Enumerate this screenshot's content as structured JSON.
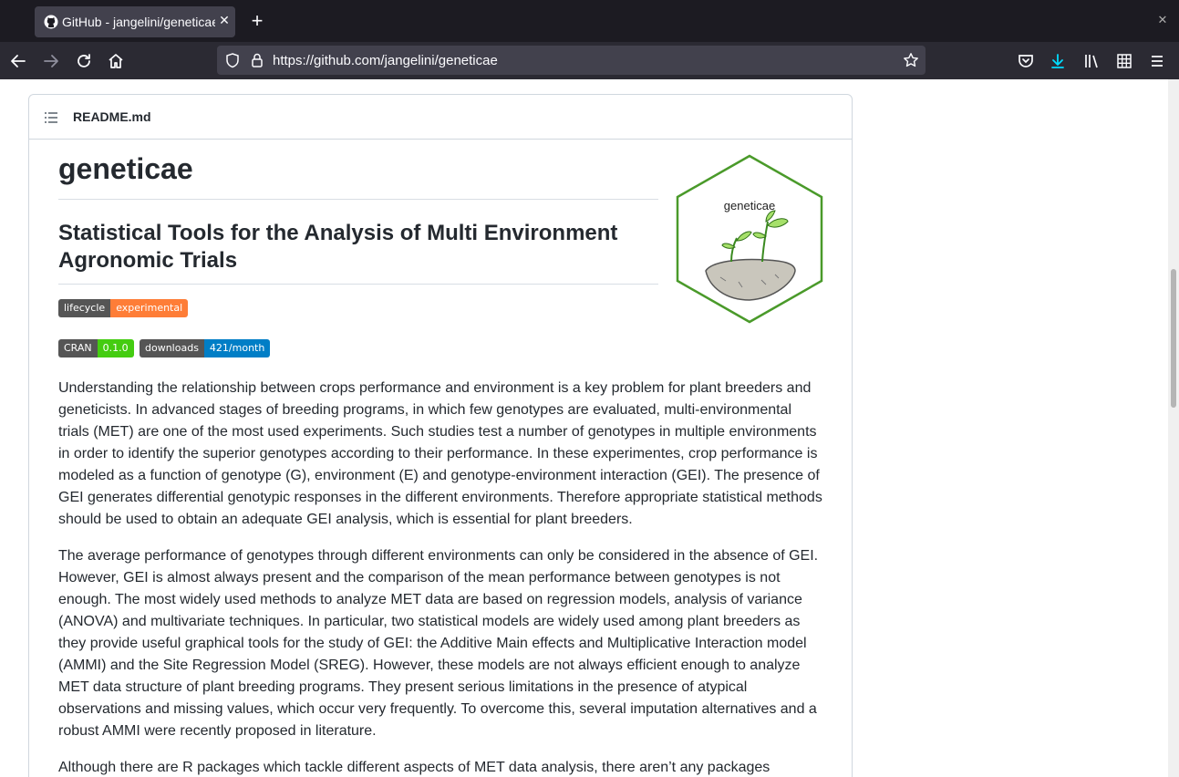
{
  "browser": {
    "tab_title": "GitHub - jangelini/geneticae",
    "url": "https://github.com/jangelini/geneticae"
  },
  "readme": {
    "filename": "README.md",
    "title": "geneticae",
    "subtitle": "Statistical Tools for the Analysis of Multi Environment Agronomic Trials",
    "logo_text": "geneticae",
    "badges": {
      "lifecycle": {
        "label": "lifecycle",
        "value": "experimental",
        "color": "#fe7d37"
      },
      "cran": {
        "label": "CRAN",
        "value": "0.1.0",
        "color": "#4c1"
      },
      "downloads": {
        "label": "downloads",
        "value": "421/month",
        "color": "#007ec6"
      }
    },
    "paragraphs": [
      "Understanding the relationship between crops performance and environment is a key problem for plant breeders and geneticists. In advanced stages of breeding programs, in which few genotypes are evaluated, multi-environmental trials (MET) are one of the most used experiments. Such studies test a number of genotypes in multiple environments in order to identify the superior genotypes according to their performance. In these experimentes, crop performance is modeled as a function of genotype (G), environment (E) and genotype-environment interaction (GEI). The presence of GEI generates differential genotypic responses in the different environments. Therefore appropriate statistical methods should be used to obtain an adequate GEI analysis, which is essential for plant breeders.",
      "The average performance of genotypes through different environments can only be considered in the absence of GEI. However, GEI is almost always present and the comparison of the mean performance between genotypes is not enough. The most widely used methods to analyze MET data are based on regression models, analysis of variance (ANOVA) and multivariate techniques. In particular, two statistical models are widely used among plant breeders as they provide useful graphical tools for the study of GEI: the Additive Main effects and Multiplicative Interaction model (AMMI) and the Site Regression Model (SREG). However, these models are not always efficient enough to analyze MET data structure of plant breeding programs. They present serious limitations in the presence of atypical observations and missing values, which occur very frequently. To overcome this, several imputation alternatives and a robust AMMI were recently proposed in literature.",
      "Although there are R packages which tackle different aspects of MET data analysis, there aren’t any packages"
    ]
  }
}
